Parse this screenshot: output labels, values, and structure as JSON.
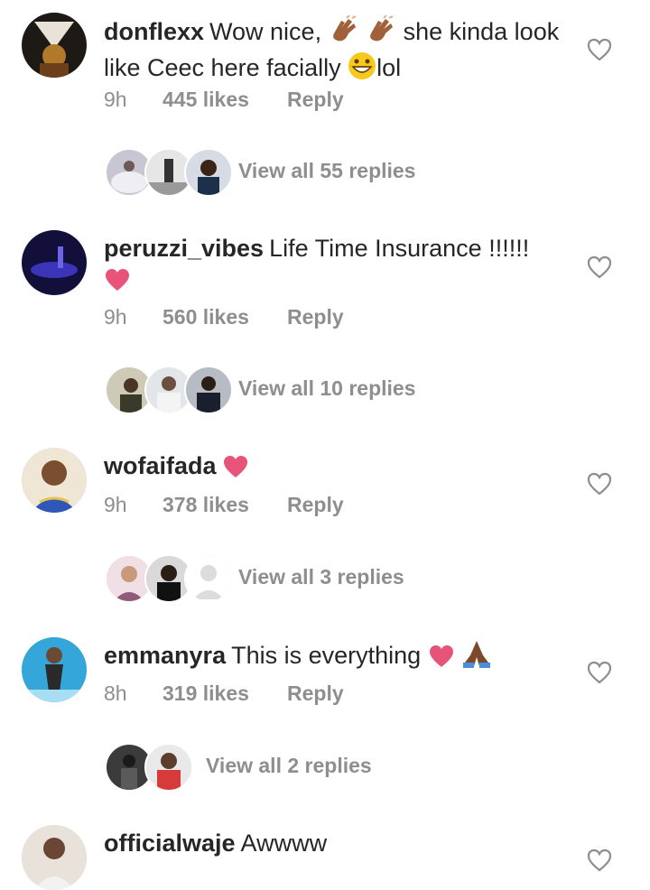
{
  "colors": {
    "text": "#262626",
    "meta": "#8e8e8e",
    "heart": "#e8537a",
    "skin": "#a0613a"
  },
  "comments": [
    {
      "username": "donflexx",
      "text_a": "Wow nice, ",
      "text_b": " she kinda look like Ceec here facially ",
      "text_c": "lol",
      "time": "9h",
      "likes": "445 likes",
      "reply": "Reply",
      "view_replies": "View all 55 replies"
    },
    {
      "username": "peruzzi_vibes",
      "text_a": "Life Time Insurance !!!!!!",
      "time": "9h",
      "likes": "560 likes",
      "reply": "Reply",
      "view_replies": "View all 10 replies"
    },
    {
      "username": "wofaifada",
      "time": "9h",
      "likes": "378 likes",
      "reply": "Reply",
      "view_replies": "View all 3 replies"
    },
    {
      "username": "emmanyra",
      "text_a": "This is everything ",
      "time": "8h",
      "likes": "319 likes",
      "reply": "Reply",
      "view_replies": "View all 2 replies"
    },
    {
      "username": "officialwaje",
      "text_a": "Awwww"
    }
  ]
}
